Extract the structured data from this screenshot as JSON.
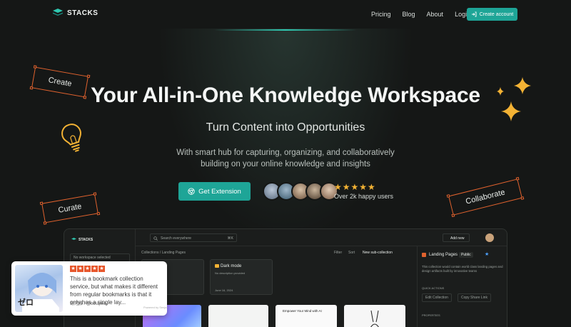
{
  "nav": {
    "brand": "STACKS",
    "links": [
      "Pricing",
      "Blog",
      "About",
      "Login"
    ],
    "cta": "Create account"
  },
  "hero": {
    "title": "Your All-in-One Knowledge Workspace",
    "subtitle": "Turn Content into Opportunities",
    "description": "With smart hub for capturing, organizing, and collaboratively building on your online knowledge and insights",
    "cta": "Get Extension",
    "stars": "★★★★★",
    "users_label": "Over 2k happy users"
  },
  "tags": {
    "create": "Create",
    "curate": "Curate",
    "collaborate": "Collaborate"
  },
  "app": {
    "brand": "STACKS",
    "search_placeholder": "Search everywhere",
    "search_shortcut": "⌘K",
    "workspace": "No workspace selected",
    "breadcrumb": "Collections / Landing Pages",
    "filter": "Filter",
    "sort": "Sort",
    "new_sub": "New sub-collection",
    "add_new": "Add new",
    "card2_title": "Dark mode",
    "card2_sub": "No description provided",
    "card2_date": "June 16, 2024",
    "panel_title": "Landing Pages",
    "panel_badge": "Public",
    "panel_desc": "This collection would contain world class landing pages and design artifacts built by innovative teams",
    "quick_actions": "QUICK ACTIONS",
    "edit_collection": "Edit Collection",
    "copy_share": "Copy Share Link",
    "properties": "PROPERTIES",
    "thumb_caption": "Empower Your Mind with AI"
  },
  "review": {
    "stars": [
      "★",
      "★",
      "★",
      "★",
      "★"
    ],
    "text": "This is a bookmark collection service, but what makes it different from regular bookmarks is that it only has a single lay...",
    "author": "聡汀雅 / @bestpika",
    "powered": "Powered by Senja"
  },
  "colors": {
    "accent": "#1ea597",
    "background": "#151716",
    "tag_border": "#e0622e",
    "star": "#f3b234"
  }
}
